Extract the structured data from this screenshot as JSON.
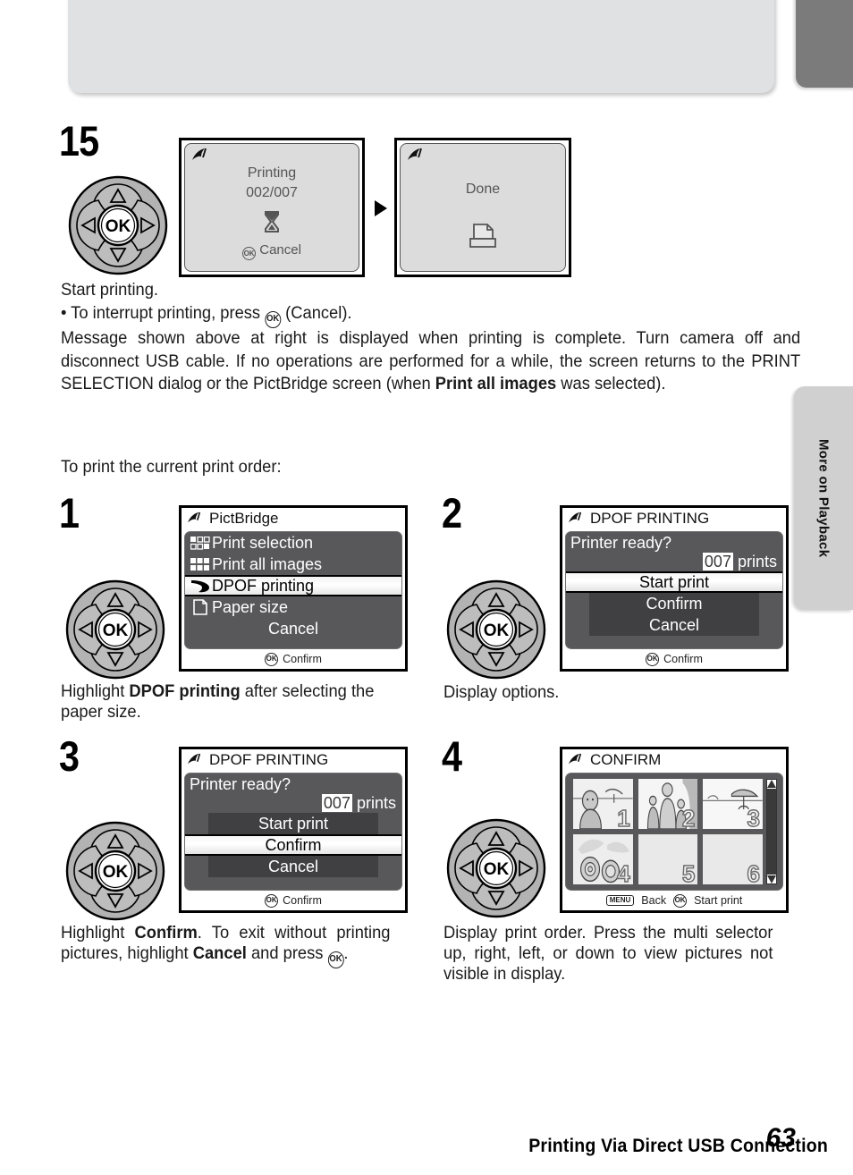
{
  "header": {
    "title": "Printing Via Direct USB Connection"
  },
  "side_tab": {
    "label": "More on Playback"
  },
  "page": {
    "number": "63"
  },
  "step15": {
    "number": "15",
    "screen_printing": {
      "line1": "Printing",
      "line2": "002/007",
      "hourglass_icon": "hourglass-icon",
      "footer_label": "Cancel",
      "footer_icon": "ok-button-icon",
      "feather_icon": "pictbridge-feather-icon"
    },
    "screen_done": {
      "line1": "Done",
      "printer_icon": "printer-icon",
      "feather_icon": "pictbridge-feather-icon"
    },
    "transition_icon": "right-arrow-icon",
    "caption_line1": "Start printing.",
    "caption_line2_pre": "• To interrupt printing, press ",
    "caption_line2_post": " (Cancel).",
    "paragraph_part1": "Message shown above at right is displayed when printing is complete. Turn camera off and disconnect USB cable. If no operations are performed for a while, the screen returns to the PRINT SELECTION dialog or the PictBridge screen (when ",
    "paragraph_bold": "Print all images",
    "paragraph_part2": " was selected)."
  },
  "intro_line": "To print the current print order:",
  "step1": {
    "number": "1",
    "screen": {
      "title": "PictBridge",
      "feather_icon": "pictbridge-feather-icon",
      "items": [
        {
          "label": "Print selection",
          "icon": "print-selection-grid-icon",
          "selected": false
        },
        {
          "label": "Print all images",
          "icon": "print-all-grid-icon",
          "selected": false
        },
        {
          "label": "DPOF printing",
          "icon": "dpof-icon",
          "selected": true
        },
        {
          "label": "Paper size",
          "icon": "paper-size-icon",
          "selected": false
        },
        {
          "label": "Cancel",
          "icon": "",
          "selected": false
        }
      ],
      "footer_label": "Confirm",
      "footer_icon": "ok-button-icon"
    },
    "caption_pre": "Highlight ",
    "caption_bold": "DPOF printing",
    "caption_post": " after selecting the paper size."
  },
  "step2": {
    "number": "2",
    "screen": {
      "title": "DPOF PRINTING",
      "feather_icon": "pictbridge-feather-icon",
      "question": "Printer ready?",
      "count": "007",
      "count_unit": "prints",
      "options": [
        {
          "label": "Start print",
          "selected": true
        },
        {
          "label": "Confirm",
          "selected": false
        },
        {
          "label": "Cancel",
          "selected": false
        }
      ],
      "footer_label": "Confirm",
      "footer_icon": "ok-button-icon"
    },
    "caption": "Display options."
  },
  "step3": {
    "number": "3",
    "screen": {
      "title": "DPOF PRINTING",
      "feather_icon": "pictbridge-feather-icon",
      "question": "Printer ready?",
      "count": "007",
      "count_unit": "prints",
      "options": [
        {
          "label": "Start print",
          "selected": false
        },
        {
          "label": "Confirm",
          "selected": true
        },
        {
          "label": "Cancel",
          "selected": false
        }
      ],
      "footer_label": "Confirm",
      "footer_icon": "ok-button-icon"
    },
    "caption_part1": "Highlight ",
    "caption_bold1": "Confirm",
    "caption_part2": ". To exit without printing pictures, highlight ",
    "caption_bold2": "Cancel",
    "caption_part3": " and press ",
    "caption_part4": "."
  },
  "step4": {
    "number": "4",
    "screen": {
      "title": "CONFIRM",
      "feather_icon": "pictbridge-feather-icon",
      "thumbnails": [
        {
          "number": "1",
          "art": "portrait-woman-beach"
        },
        {
          "number": "2",
          "art": "family-group"
        },
        {
          "number": "3",
          "art": "beach-parasol"
        },
        {
          "number": "4",
          "art": "flowers"
        },
        {
          "number": "5",
          "art": ""
        },
        {
          "number": "6",
          "art": ""
        }
      ],
      "scrollbar_icon": "vertical-scrollbar",
      "footer_back_icon": "menu-button-icon",
      "footer_back_label": "Back",
      "footer_start_icon": "ok-button-icon",
      "footer_start_label": "Start print"
    },
    "caption": "Display print order. Press the multi selector up, right, left, or down to view pictures not visible in display."
  },
  "multi_selector": {
    "ok_label": "OK",
    "up_icon": "triangle-up-icon",
    "down_icon": "triangle-down-icon",
    "left_icon": "triangle-left-icon",
    "right_icon": "triangle-right-icon"
  }
}
